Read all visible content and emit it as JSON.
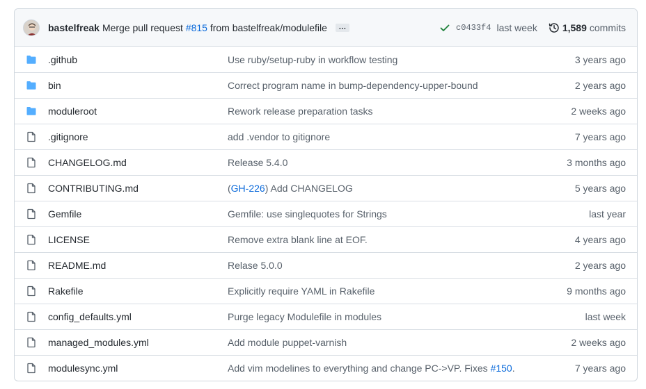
{
  "commit": {
    "author": "bastelfreak",
    "message_prefix": "Merge pull request",
    "pr_number": "#815",
    "message_suffix": "from bastelfreak/modulefile",
    "ellipsis": "…",
    "sha": "c0433f4",
    "time": "last week",
    "commits_count": "1,589",
    "commits_label": "commits",
    "icons": {
      "status": "check-icon",
      "history": "history-icon"
    },
    "colors": {
      "check": "#1a7f37",
      "link": "#0969da"
    }
  },
  "files": [
    {
      "type": "folder",
      "name": ".github",
      "message": "Use ruby/setup-ruby in workflow testing",
      "age": "3 years ago"
    },
    {
      "type": "folder",
      "name": "bin",
      "message": "Correct program name in bump-dependency-upper-bound",
      "age": "2 years ago"
    },
    {
      "type": "folder",
      "name": "moduleroot",
      "message": "Rework release preparation tasks",
      "age": "2 weeks ago"
    },
    {
      "type": "file",
      "name": ".gitignore",
      "message": "add .vendor to gitignore",
      "age": "7 years ago"
    },
    {
      "type": "file",
      "name": "CHANGELOG.md",
      "message": "Release 5.4.0",
      "age": "3 months ago"
    },
    {
      "type": "file",
      "name": "CONTRIBUTING.md",
      "message_pre": "(",
      "message_link": "GH-226",
      "message_post": ") Add CHANGELOG",
      "age": "5 years ago"
    },
    {
      "type": "file",
      "name": "Gemfile",
      "message": "Gemfile: use singlequotes for Strings",
      "age": "last year"
    },
    {
      "type": "file",
      "name": "LICENSE",
      "message": "Remove extra blank line at EOF.",
      "age": "4 years ago"
    },
    {
      "type": "file",
      "name": "README.md",
      "message": "Relase 5.0.0",
      "age": "2 years ago"
    },
    {
      "type": "file",
      "name": "Rakefile",
      "message": "Explicitly require YAML in Rakefile",
      "age": "9 months ago"
    },
    {
      "type": "file",
      "name": "config_defaults.yml",
      "message": "Purge legacy Modulefile in modules",
      "age": "last week"
    },
    {
      "type": "file",
      "name": "managed_modules.yml",
      "message": "Add module puppet-varnish",
      "age": "2 weeks ago"
    },
    {
      "type": "file",
      "name": "modulesync.yml",
      "message_pre": "Add vim modelines to everything and change PC->VP. ",
      "message_dotted": "Fixes",
      "message_space": " ",
      "message_link": "#150",
      "message_post": ".",
      "age": "7 years ago"
    }
  ],
  "icon_colors": {
    "folder": "#54aeff",
    "file": "#57606a"
  }
}
